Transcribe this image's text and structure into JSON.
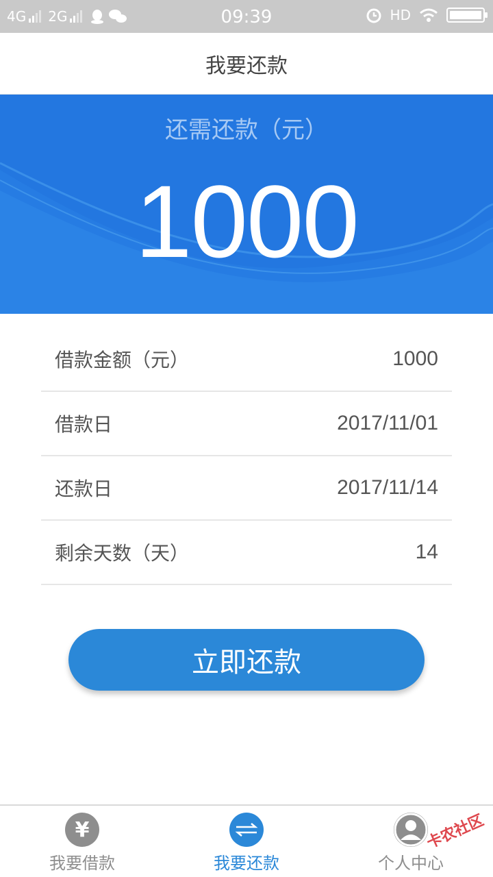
{
  "status_bar": {
    "network_1": "4G",
    "network_2": "2G",
    "time": "09:39",
    "hd": "HD",
    "icons": [
      "qq-icon",
      "wechat-icon",
      "alarm-icon",
      "wifi-icon",
      "battery-icon"
    ]
  },
  "header": {
    "title": "我要还款"
  },
  "hero": {
    "label": "还需还款（元）",
    "amount": "1000"
  },
  "details": [
    {
      "label": "借款金额（元）",
      "value": "1000"
    },
    {
      "label": "借款日",
      "value": "2017/11/01"
    },
    {
      "label": "还款日",
      "value": "2017/11/14"
    },
    {
      "label": "剩余天数（天）",
      "value": "14"
    }
  ],
  "actions": {
    "repay_label": "立即还款"
  },
  "tabs": [
    {
      "label": "我要借款",
      "icon": "yen-icon",
      "active": false
    },
    {
      "label": "我要还款",
      "icon": "exchange-icon",
      "active": true
    },
    {
      "label": "个人中心",
      "icon": "user-icon",
      "active": false
    }
  ],
  "watermark": "卡农社区",
  "colors": {
    "primary": "#2b88d8",
    "hero_bg": "#2377e0",
    "status_bar": "#c9c9c9"
  }
}
